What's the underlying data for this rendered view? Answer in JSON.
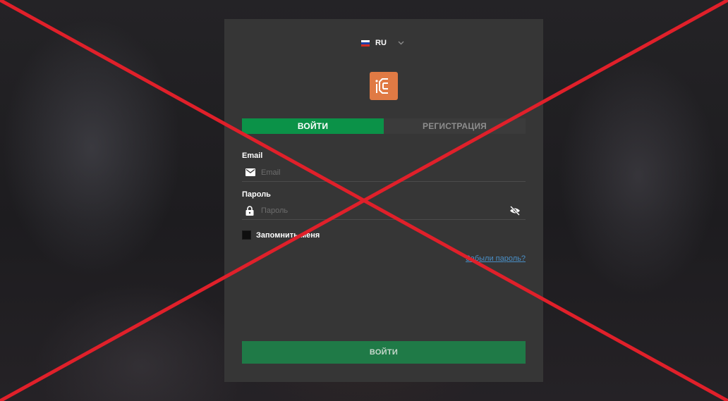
{
  "language": {
    "code": "RU",
    "flag_colors": [
      "#ffffff",
      "#1c3fa8",
      "#d52b1e"
    ]
  },
  "brand": {
    "logo_icon": "brand-logo-icon",
    "accent_color": "#e07a44"
  },
  "tabs": [
    {
      "label": "ВОЙТИ",
      "active": true
    },
    {
      "label": "РЕГИСТРАЦИЯ",
      "active": false
    }
  ],
  "form": {
    "email_label": "Email",
    "email_placeholder": "Email",
    "password_label": "Пароль",
    "password_placeholder": "Пароль",
    "remember_label": "Запомнить меня",
    "forgot_link": "Забыли пароль?",
    "submit_label": "ВОЙТИ"
  },
  "colors": {
    "primary_green": "#0b9248",
    "submit_green": "#1f7a47",
    "link_blue": "#4a90c8",
    "cross_red": "#e0202a"
  }
}
